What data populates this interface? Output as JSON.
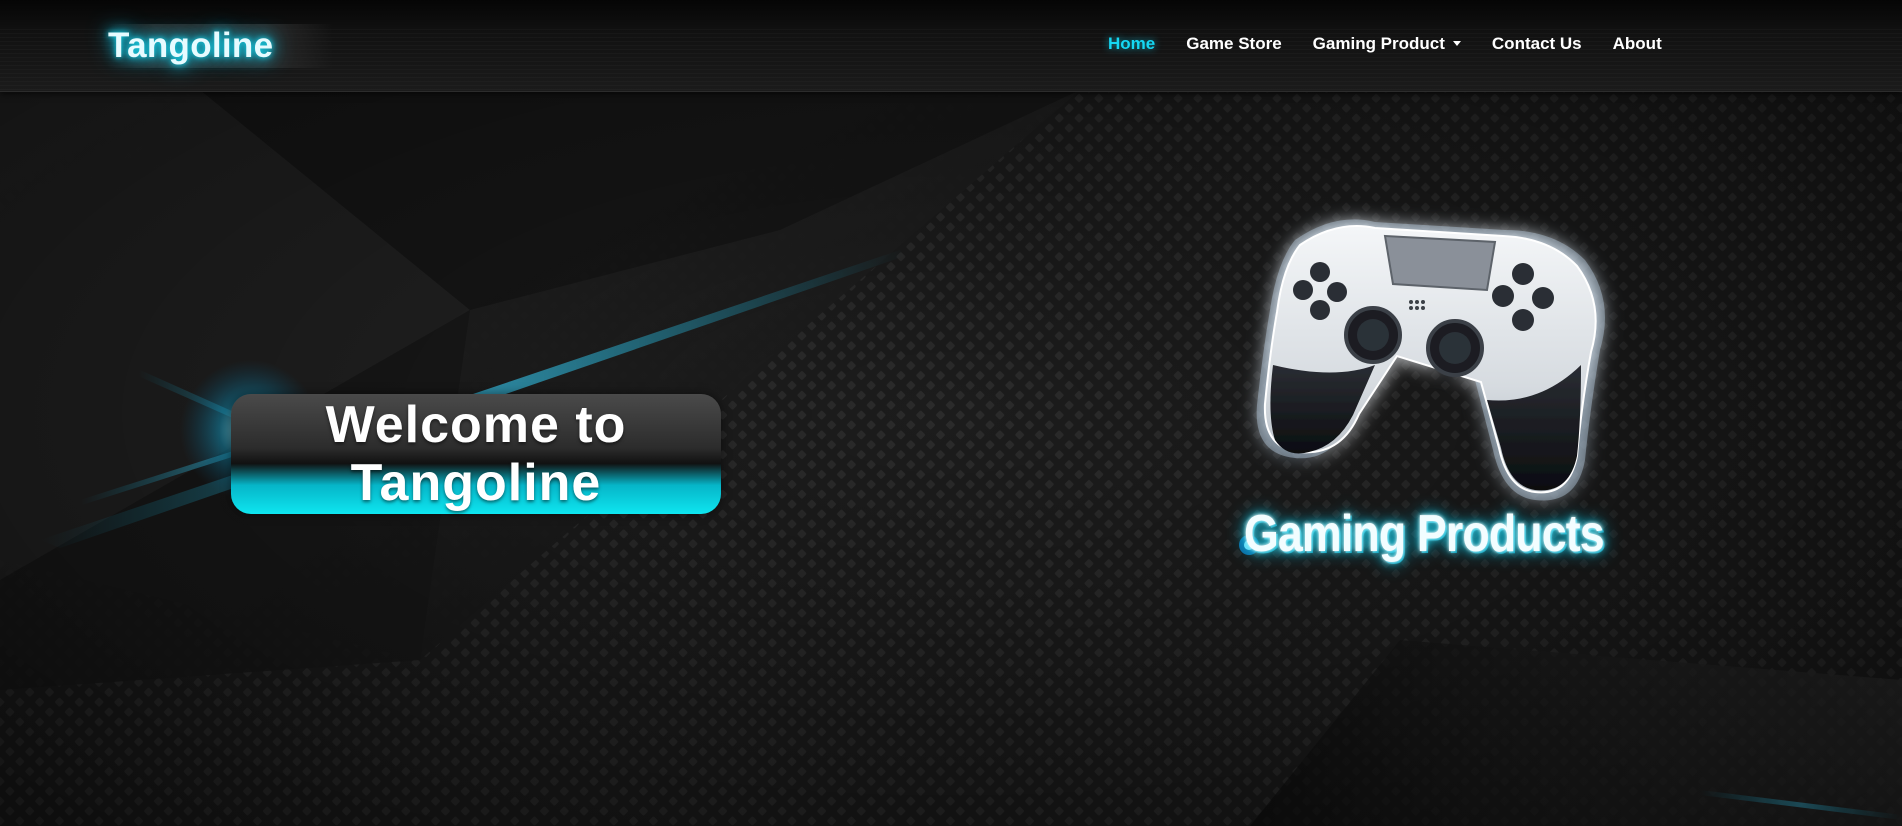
{
  "brand": {
    "name": "Tangoline"
  },
  "nav": {
    "items": [
      {
        "label": "Home",
        "active": true
      },
      {
        "label": "Game Store"
      },
      {
        "label": "Gaming Product",
        "dropdown": true
      },
      {
        "label": "Contact Us"
      },
      {
        "label": "About"
      }
    ]
  },
  "hero": {
    "welcome_line1": "Welcome to",
    "welcome_line2": "Tangoline",
    "products_label": "Gaming Products",
    "image_icon": "gamepad-icon"
  },
  "colors": {
    "accent": "#15d7f3",
    "text": "#ffffff",
    "background": "#151515"
  }
}
